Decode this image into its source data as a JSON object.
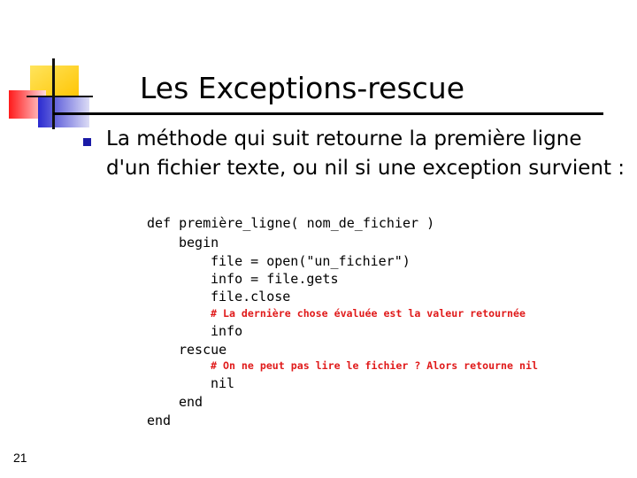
{
  "slide": {
    "title": "Les Exceptions-rescue",
    "bullet": "La méthode qui suit retourne la première ligne d'un fichier texte, ou nil si une exception survient :",
    "code": [
      "def première_ligne( nom_de_fichier )",
      "begin",
      "file = open(\"un_fichier\")",
      "info = file.gets",
      "file.close",
      "# La dernière chose évaluée est la valeur retournée",
      "info",
      "rescue",
      "# On ne peut pas lire le fichier ? Alors retourne nil",
      "nil",
      "end",
      "end"
    ],
    "page_number": "21"
  },
  "colors": {
    "accent_yellow": "#ffd700",
    "accent_red": "#e8172a",
    "accent_blue": "#1a1aa6",
    "comment": "#e01a1a"
  }
}
